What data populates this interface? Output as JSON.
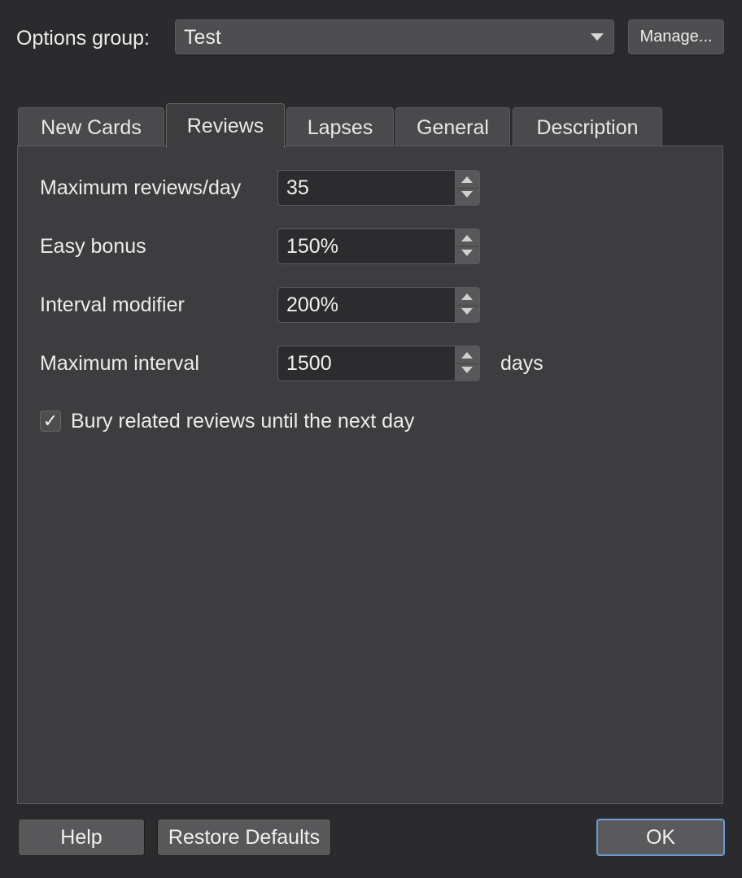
{
  "options_group": {
    "label": "Options group:",
    "selected": "Test",
    "arrow_icon": "chevron-down-icon",
    "manage_label": "Manage..."
  },
  "tabs": [
    {
      "label": "New Cards",
      "active": false
    },
    {
      "label": "Reviews",
      "active": true
    },
    {
      "label": "Lapses",
      "active": false
    },
    {
      "label": "General",
      "active": false
    },
    {
      "label": "Description",
      "active": false
    }
  ],
  "reviews": {
    "fields": [
      {
        "label": "Maximum reviews/day",
        "value": "35"
      },
      {
        "label": "Easy bonus",
        "value": "150%"
      },
      {
        "label": "Interval modifier",
        "value": "200%"
      },
      {
        "label": "Maximum interval",
        "value": "1500",
        "suffix": "days"
      }
    ],
    "bury": {
      "checked": true,
      "checkmark": "✓",
      "label": "Bury related reviews until the next day"
    }
  },
  "footer": {
    "help_label": "Help",
    "restore_label": "Restore Defaults",
    "ok_label": "OK"
  },
  "colors": {
    "window_bg": "#2b2b2d",
    "panel_bg": "#3d3d3f",
    "focus_accent": "#6b9ad1"
  }
}
